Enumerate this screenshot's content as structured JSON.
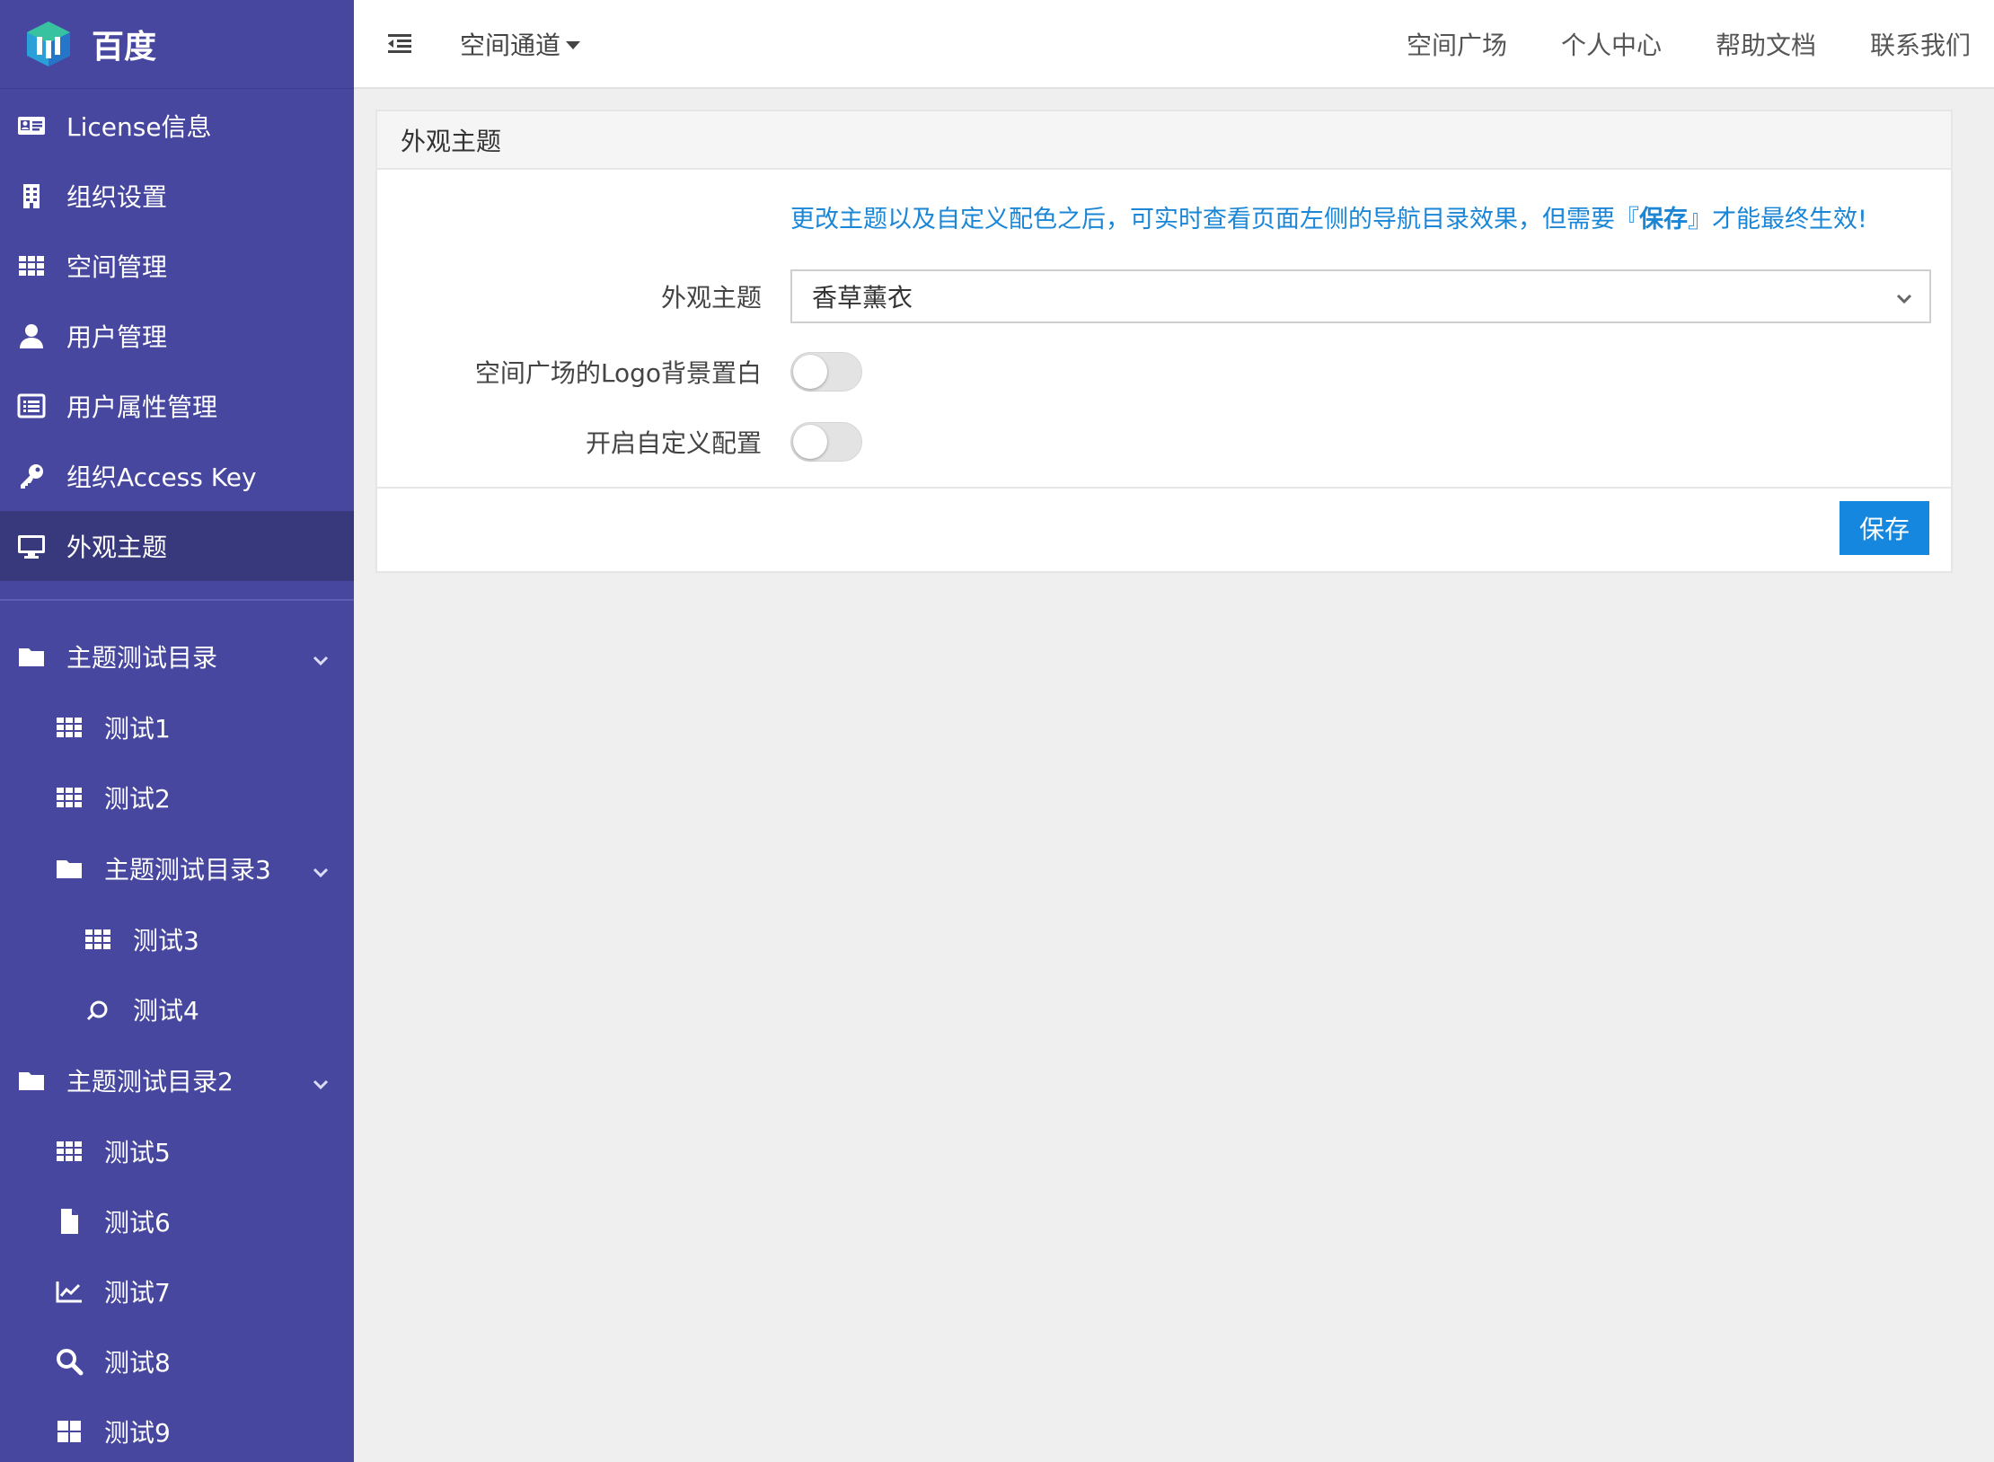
{
  "brand": {
    "name": "百度"
  },
  "sidebar": {
    "items": [
      {
        "label": "License信息",
        "icon": "id-card-icon"
      },
      {
        "label": "组织设置",
        "icon": "building-icon"
      },
      {
        "label": "空间管理",
        "icon": "grid-icon"
      },
      {
        "label": "用户管理",
        "icon": "user-icon"
      },
      {
        "label": "用户属性管理",
        "icon": "list-icon"
      },
      {
        "label": "组织Access Key",
        "icon": "key-icon"
      },
      {
        "label": "外观主题",
        "icon": "monitor-icon",
        "active": true
      }
    ],
    "tree": [
      {
        "label": "主题测试目录",
        "icon": "folder-icon"
      },
      {
        "label": "测试1",
        "icon": "grid-icon"
      },
      {
        "label": "测试2",
        "icon": "grid-icon"
      },
      {
        "label": "主题测试目录3",
        "icon": "folder-icon"
      },
      {
        "label": "测试3",
        "icon": "grid-icon"
      },
      {
        "label": "测试4",
        "icon": "refresh-icon"
      },
      {
        "label": "主题测试目录2",
        "icon": "folder-icon"
      },
      {
        "label": "测试5",
        "icon": "grid-icon"
      },
      {
        "label": "测试6",
        "icon": "file-icon"
      },
      {
        "label": "测试7",
        "icon": "line-chart-icon"
      },
      {
        "label": "测试8",
        "icon": "search-icon"
      },
      {
        "label": "测试9",
        "icon": "windows-icon"
      }
    ]
  },
  "topbar": {
    "space_dropdown": "空间通道",
    "links": [
      "空间广场",
      "个人中心",
      "帮助文档",
      "联系我们"
    ]
  },
  "panel": {
    "title": "外观主题",
    "notice_before": "更改主题以及自定义配色之后，可实时查看页面左侧的导航目录效果，但需要『",
    "notice_bold": "保存",
    "notice_after": "』才能最终生效!",
    "theme_label": "外观主题",
    "theme_value": "香草薰衣",
    "logo_bg_label": "空间广场的Logo背景置白",
    "logo_bg_on": false,
    "custom_label": "开启自定义配置",
    "custom_on": false,
    "save_label": "保存"
  },
  "colors": {
    "sidebar_bg": "#47479f",
    "sidebar_active": "#38387d",
    "accent": "#1587de",
    "notice_text": "#1b86d6"
  }
}
